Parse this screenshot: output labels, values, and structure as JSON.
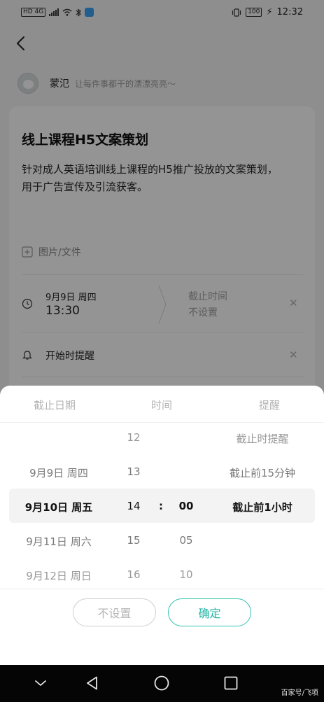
{
  "status_bar": {
    "network": "HD 4G",
    "battery": "100",
    "time": "12:32"
  },
  "author": {
    "name": "蒙氾",
    "signature": "让每件事都干的漂漂亮亮～"
  },
  "task": {
    "title": "线上课程H5文案策划",
    "description": "针对成人英语培训线上课程的H5推广投放的文案策划，用于广告宣传及引流获客。",
    "attachment_label": "图片/文件",
    "start_date": "9月9日 周四",
    "start_time": "13:30",
    "deadline_label": "截止时间",
    "deadline_value": "不设置",
    "reminder_label": "开始时提醒"
  },
  "picker": {
    "headers": [
      "截止日期",
      "时间",
      "提醒"
    ],
    "dates": [
      "9月9日 周四",
      "9月10日 周五",
      "9月11日 周六",
      "9月12日 周日"
    ],
    "hours": [
      "12",
      "13",
      "14",
      "15",
      "16"
    ],
    "separator": ":",
    "minutes": [
      "00",
      "05",
      "10"
    ],
    "reminders": [
      "截止时提醒",
      "截止前15分钟",
      "截止前1小时"
    ]
  },
  "buttons": {
    "cancel": "不设置",
    "confirm": "确定"
  },
  "watermark": "百家号/飞项",
  "colors": {
    "accent": "#24b5a6",
    "overlay": "rgba(0,0,0,0.42)"
  }
}
